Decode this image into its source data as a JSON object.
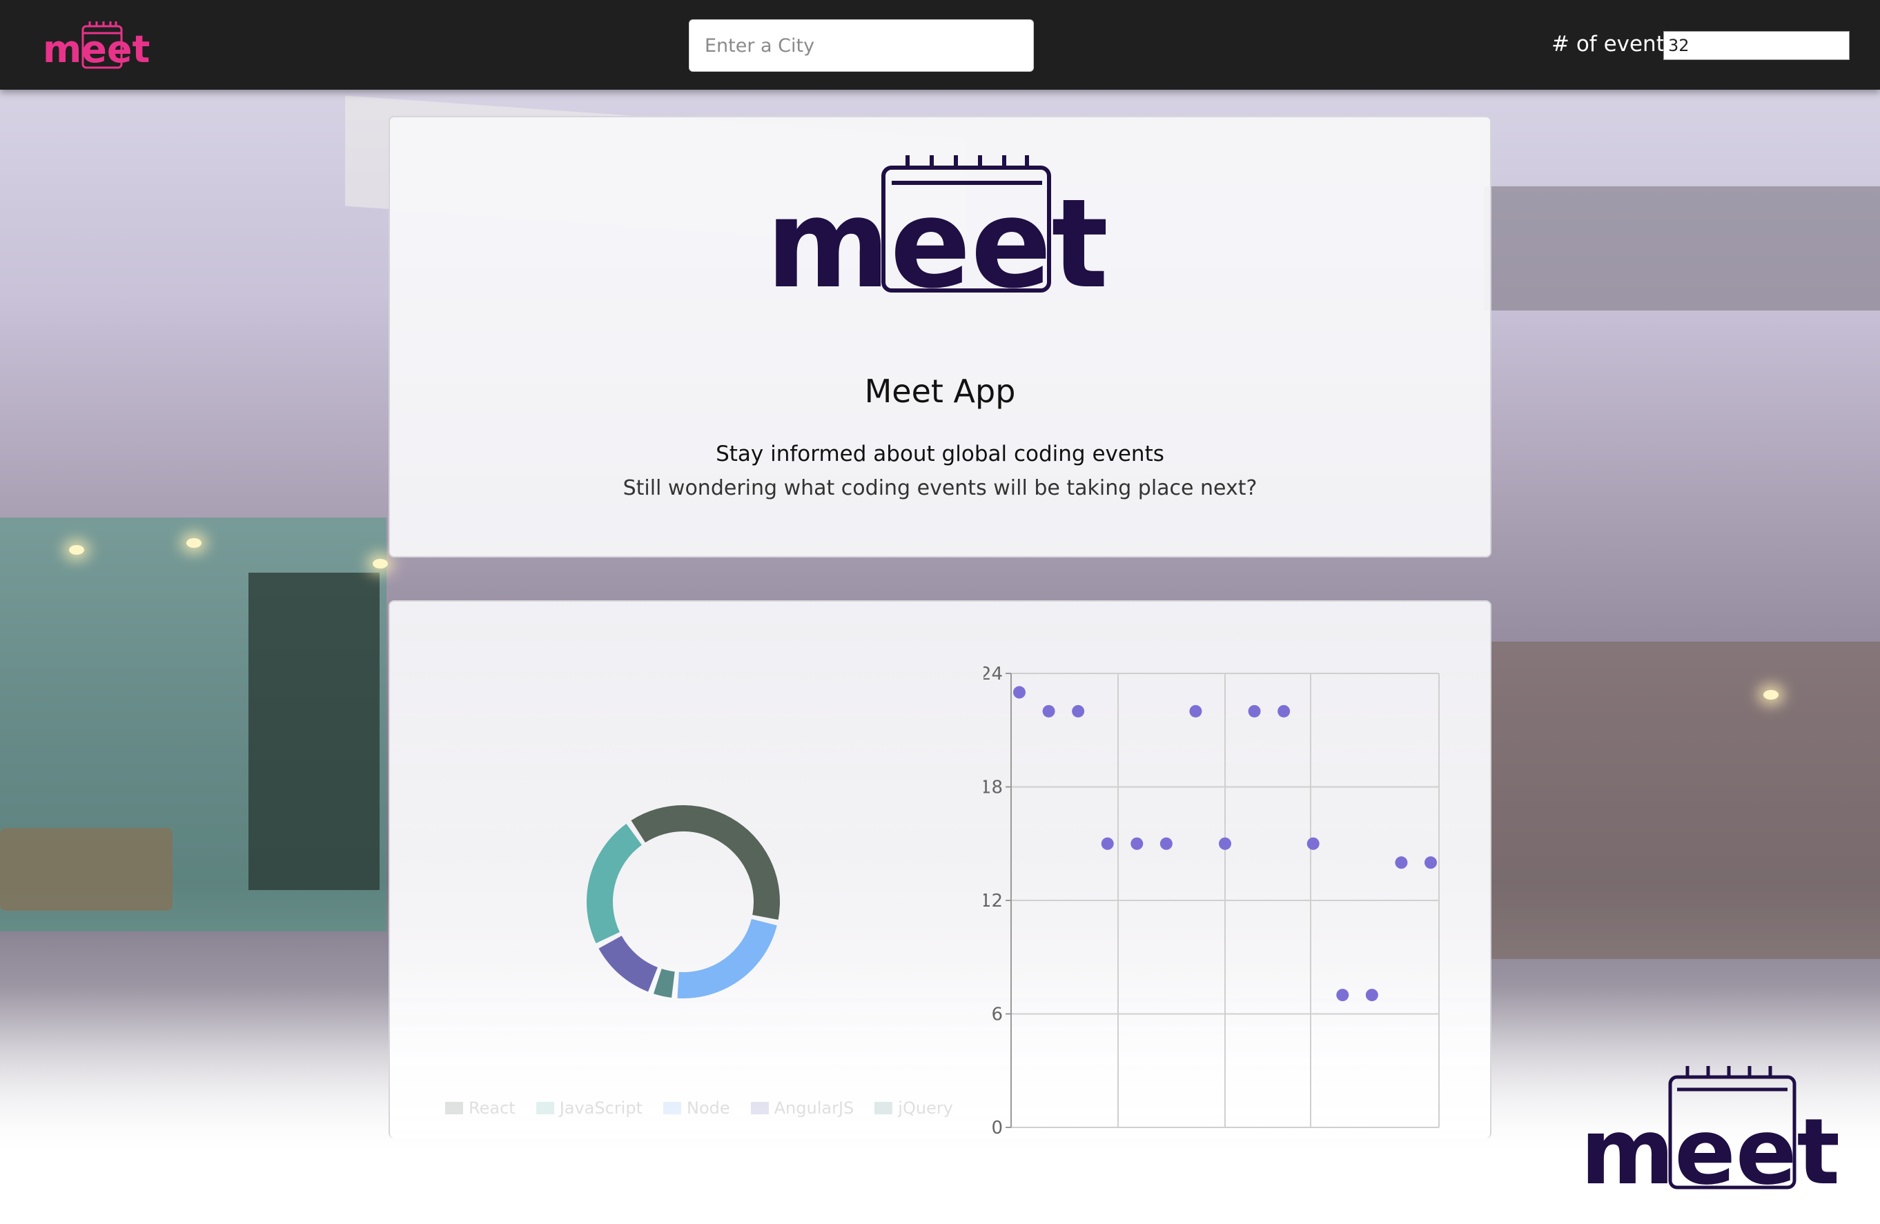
{
  "navbar": {
    "logo_text": "meet",
    "city_placeholder": "Enter a City",
    "events_label": "# of events",
    "events_value": "32"
  },
  "hero": {
    "logo_text": "meet",
    "title": "Meet App",
    "tagline": "Stay informed about global coding events",
    "subline": "Still wondering what coding events will be taking place next?"
  },
  "colors": {
    "navbar_bg": "#1f1f1f",
    "logo_pink": "#e8338a",
    "logo_navy": "#1f0f45",
    "scatter_point": "#7b6fd6"
  },
  "chart_data": [
    {
      "type": "pie",
      "series": [
        {
          "value": 38,
          "color": "#56645a"
        },
        {
          "value": 23,
          "color": "#7eb6f7"
        },
        {
          "value": 4,
          "color": "#5a8c8a"
        },
        {
          "value": 12,
          "color": "#6c68b0"
        },
        {
          "value": 23,
          "color": "#5fb2ad"
        }
      ],
      "legend": [
        "React",
        "JavaScript",
        "Node",
        "AngularJS",
        "jQuery"
      ],
      "legend_colors": [
        "#56645a",
        "#5fb2ad",
        "#7eb6f7",
        "#6c68b0",
        "#5a8c8a"
      ]
    },
    {
      "type": "scatter",
      "ylim": [
        0,
        24
      ],
      "yticks": [
        "0",
        "6",
        "12",
        "18",
        "24"
      ],
      "x": [
        1,
        2,
        3,
        4,
        5,
        6,
        7,
        8,
        9,
        10,
        11,
        12,
        13,
        14,
        15
      ],
      "values": [
        23,
        22,
        22,
        15,
        15,
        15,
        22,
        15,
        22,
        22,
        15,
        7,
        7,
        14,
        14
      ],
      "grid": true
    }
  ],
  "corner": {
    "logo_text": "meet"
  }
}
